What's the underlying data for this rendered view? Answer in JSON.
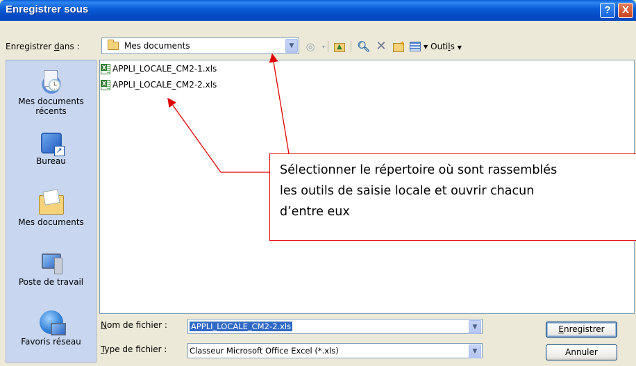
{
  "window": {
    "title": "Enregistrer sous",
    "help_button": "?",
    "close_button": "X"
  },
  "save_in": {
    "label_prefix": "Enregistrer ",
    "label_accel": "d",
    "label_suffix": "ans :",
    "value": "Mes documents",
    "folder_icon": "folder-icon"
  },
  "toolbar": {
    "items": [
      "back-icon",
      "up-folder-icon",
      "search-web-icon",
      "delete-icon",
      "new-folder-icon",
      "views-icon"
    ],
    "tools_label_prefix": "Outi",
    "tools_label_accel": "l",
    "tools_label_suffix": "s"
  },
  "places": [
    {
      "label_line1": "Mes documents",
      "label_line2": "récents",
      "icon": "recent-documents-icon"
    },
    {
      "label_line1": "Bureau",
      "label_line2": "",
      "icon": "desktop-icon"
    },
    {
      "label_line1": "Mes documents",
      "label_line2": "",
      "icon": "my-documents-icon"
    },
    {
      "label_line1": "Poste de travail",
      "label_line2": "",
      "icon": "my-computer-icon"
    },
    {
      "label_line1": "Favoris réseau",
      "label_line2": "",
      "icon": "network-places-icon"
    }
  ],
  "files": [
    {
      "name": "APPLI_LOCALE_CM2-1.xls",
      "icon": "excel-file-icon"
    },
    {
      "name": "APPLI_LOCALE_CM2-2.xls",
      "icon": "excel-file-icon"
    }
  ],
  "callout": {
    "line1": "Sélectionner le répertoire où sont rassemblés",
    "line2": "les outils de saisie locale et ouvrir chacun",
    "line3": "d’entre eux"
  },
  "filename": {
    "label_accel": "N",
    "label_rest": "om de fichier :",
    "value": "APPLI_LOCALE_CM2-2.xls"
  },
  "filetype": {
    "label_accel": "T",
    "label_rest": "ype de fichier :",
    "value": "Classeur Microsoft Office Excel (*.xls)"
  },
  "buttons": {
    "save_accel": "E",
    "save_rest": "nregistrer",
    "cancel": "Annuler"
  },
  "colors": {
    "title_bar": "#0a5fd8",
    "places_bar": "#c8d6f0",
    "callout_border": "#e10000",
    "selection": "#316ac5"
  }
}
